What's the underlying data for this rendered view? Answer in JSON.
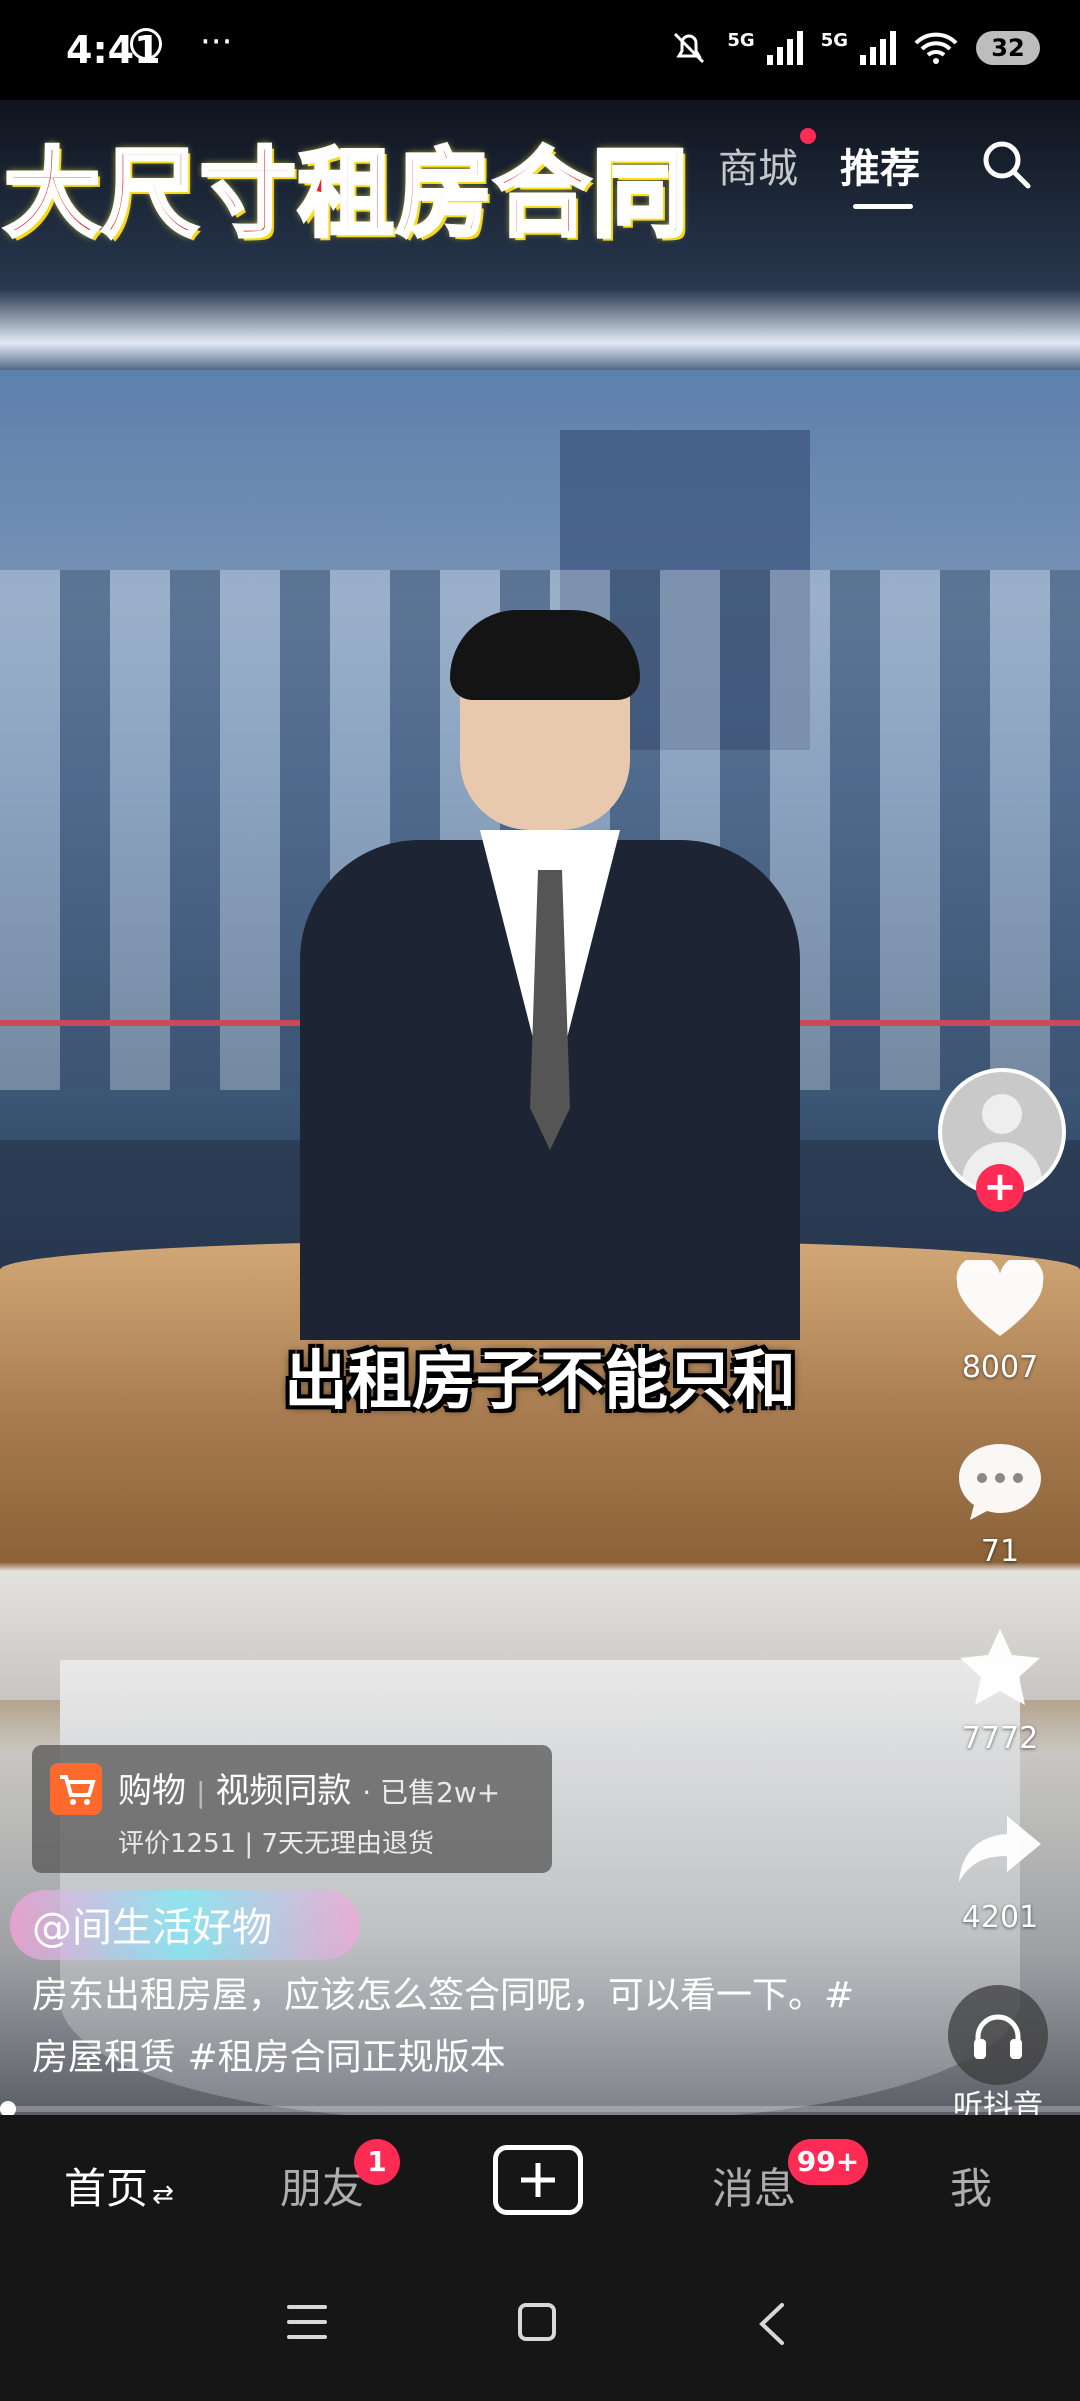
{
  "status_bar": {
    "time": "4:41",
    "more": "···",
    "signal1_label": "5G",
    "signal2_label": "5G",
    "battery": "32"
  },
  "top_nav": {
    "tab_mall": "商城",
    "tab_recommend": "推荐"
  },
  "video": {
    "title_overlay": "大尺寸租房合同",
    "subtitle": "出租房子不能只和"
  },
  "actions": {
    "likes": "8007",
    "comments": "71",
    "favorites": "7772",
    "shares": "4201"
  },
  "product": {
    "category": "购物",
    "name": "视频同款",
    "sold": "· 已售2w+",
    "meta": "评价1251 | 7天无理由退货"
  },
  "author": "@间生活好物",
  "description": "房东出租房屋，应该怎么签合同呢，可以看一下。#房屋租赁 #租房合同正规版本",
  "listen": "听抖音",
  "progress": 0,
  "bottom_nav": {
    "home": "首页",
    "home_suffix": "⇄",
    "friends": "朋友",
    "friends_badge": "1",
    "messages": "消息",
    "messages_badge": "99+",
    "me": "我"
  },
  "colors": {
    "accent": "#fe2c55",
    "title_red": "#e8221e",
    "cart_orange": "#ff6a2c"
  }
}
